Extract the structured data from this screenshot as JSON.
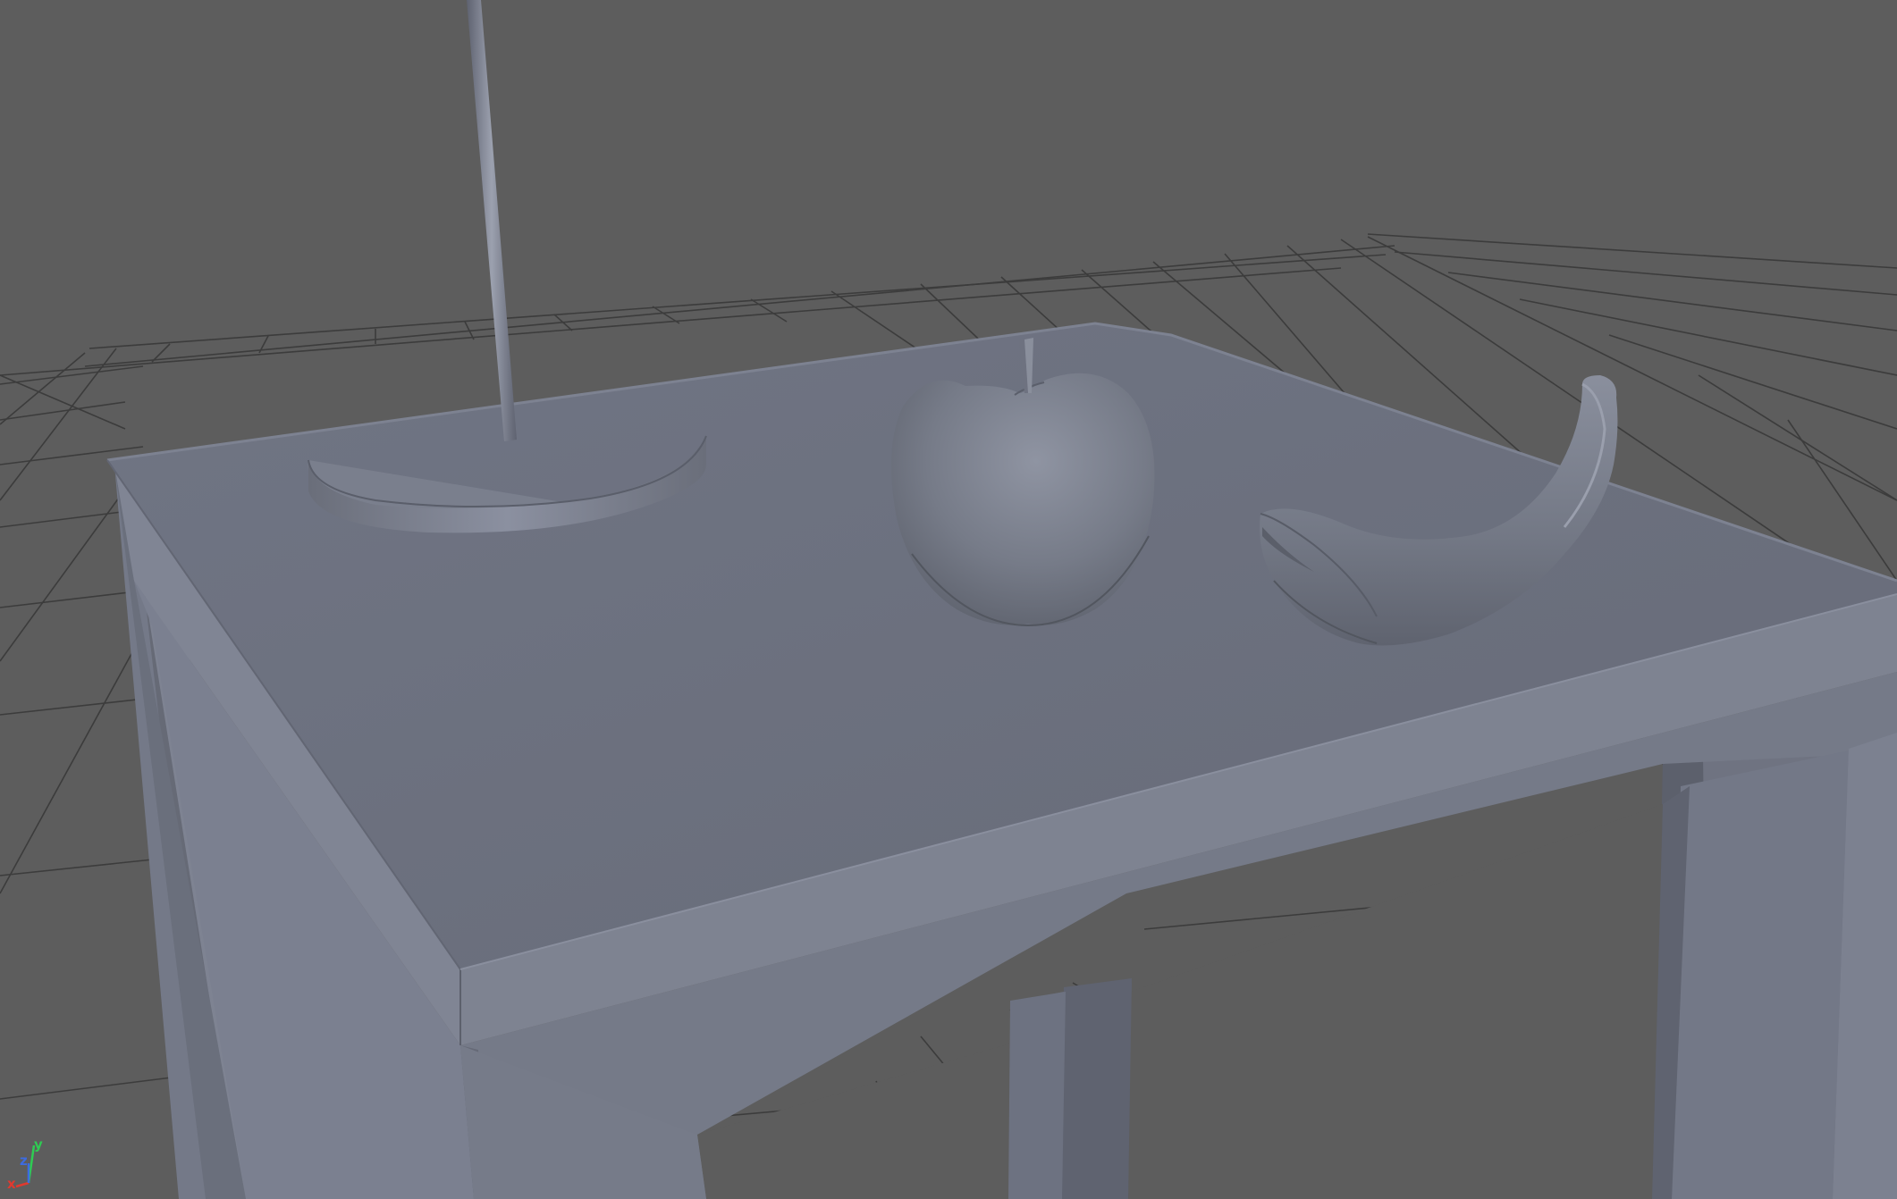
{
  "viewport": {
    "background_color": "#5d5d5d",
    "grid_color": "#3c3c3c",
    "mesh_color": "#6f7480"
  },
  "scene": {
    "objects": [
      {
        "name": "table",
        "shading": "smooth-shaded"
      },
      {
        "name": "stand-base",
        "shading": "smooth-shaded"
      },
      {
        "name": "stand-pole",
        "shading": "smooth-shaded"
      },
      {
        "name": "apple",
        "shading": "smooth-shaded"
      },
      {
        "name": "banana",
        "shading": "smooth-shaded"
      }
    ]
  },
  "axis_gizmo": {
    "x": {
      "label": "x",
      "color": "#e0392f"
    },
    "y": {
      "label": "y",
      "color": "#2ecc52"
    },
    "z": {
      "label": "z",
      "color": "#3d6be0"
    }
  }
}
